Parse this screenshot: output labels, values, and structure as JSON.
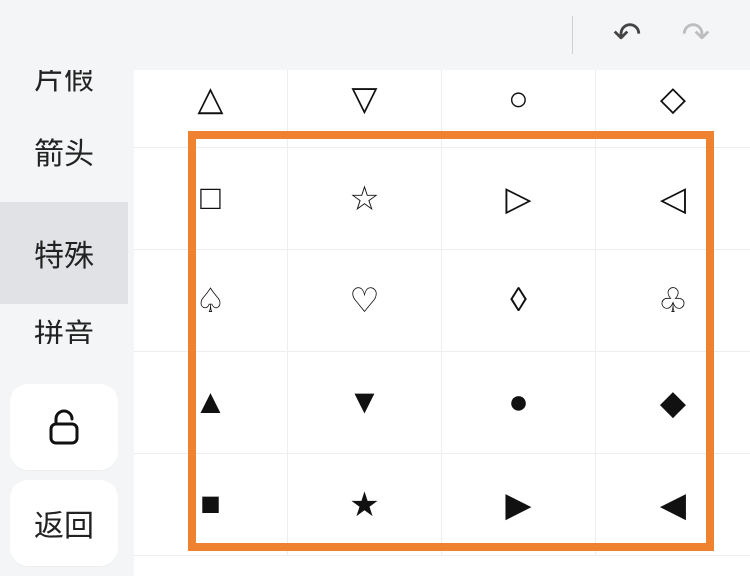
{
  "topbar": {
    "undo_glyph": "↶",
    "redo_glyph": "↷"
  },
  "sidebar": {
    "categories": [
      {
        "label": "片假",
        "key": "katakana",
        "state": "partial-top"
      },
      {
        "label": "箭头",
        "key": "arrows",
        "state": ""
      },
      {
        "label": "特殊",
        "key": "special",
        "state": "active"
      },
      {
        "label": "拼音",
        "key": "pinyin",
        "state": "partial-bottom"
      }
    ],
    "lock": {
      "name": "unlock-icon"
    },
    "back_label": "返回"
  },
  "grid": {
    "rows": [
      [
        "△",
        "▽",
        "○",
        "◇"
      ],
      [
        "□",
        "☆",
        "▷",
        "◁"
      ],
      [
        "♤",
        "♡",
        "◊",
        "♧"
      ],
      [
        "▲",
        "▼",
        "●",
        "◆"
      ],
      [
        "■",
        "★",
        "▶",
        "◀"
      ]
    ]
  },
  "highlight_color": "#ee8231"
}
